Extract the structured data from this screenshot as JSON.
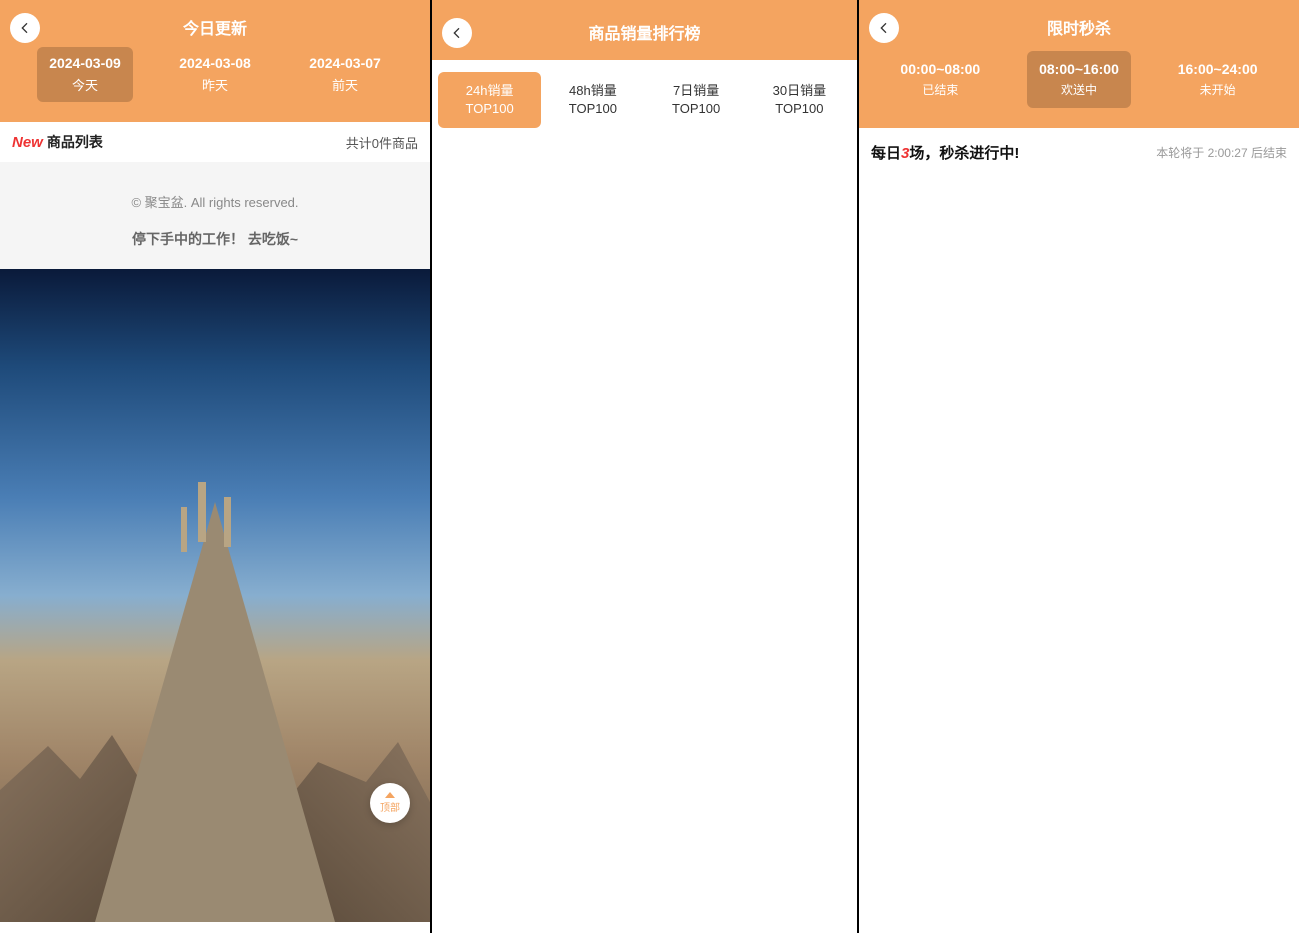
{
  "panel1": {
    "title": "今日更新",
    "dates": [
      {
        "date": "2024-03-09",
        "label": "今天"
      },
      {
        "date": "2024-03-08",
        "label": "昨天"
      },
      {
        "date": "2024-03-07",
        "label": "前天"
      }
    ],
    "listHeader": {
      "new": "New",
      "label": "商品列表",
      "count": "共计0件商品"
    },
    "footer": {
      "copyright": "© 聚宝盆. All rights reserved.",
      "msg": "停下手中的工作！ 去吃饭~"
    },
    "topBtn": "顶部"
  },
  "panel2": {
    "title": "商品销量排行榜",
    "tabs": [
      {
        "l1": "24h销量",
        "l2": "TOP100"
      },
      {
        "l1": "48h销量",
        "l2": "TOP100"
      },
      {
        "l1": "7日销量",
        "l2": "TOP100"
      },
      {
        "l1": "30日销量",
        "l2": "TOP100"
      }
    ]
  },
  "panel3": {
    "title": "限时秒杀",
    "times": [
      {
        "range": "00:00~08:00",
        "status": "已结束"
      },
      {
        "range": "08:00~16:00",
        "status": "欢送中"
      },
      {
        "range": "16:00~24:00",
        "status": "未开始"
      }
    ],
    "flashPrefix": "每日",
    "flashNum": "3",
    "flashSuffix": "场，秒杀进行中!",
    "countdown": "本轮将于 2:00:27 后结束"
  }
}
